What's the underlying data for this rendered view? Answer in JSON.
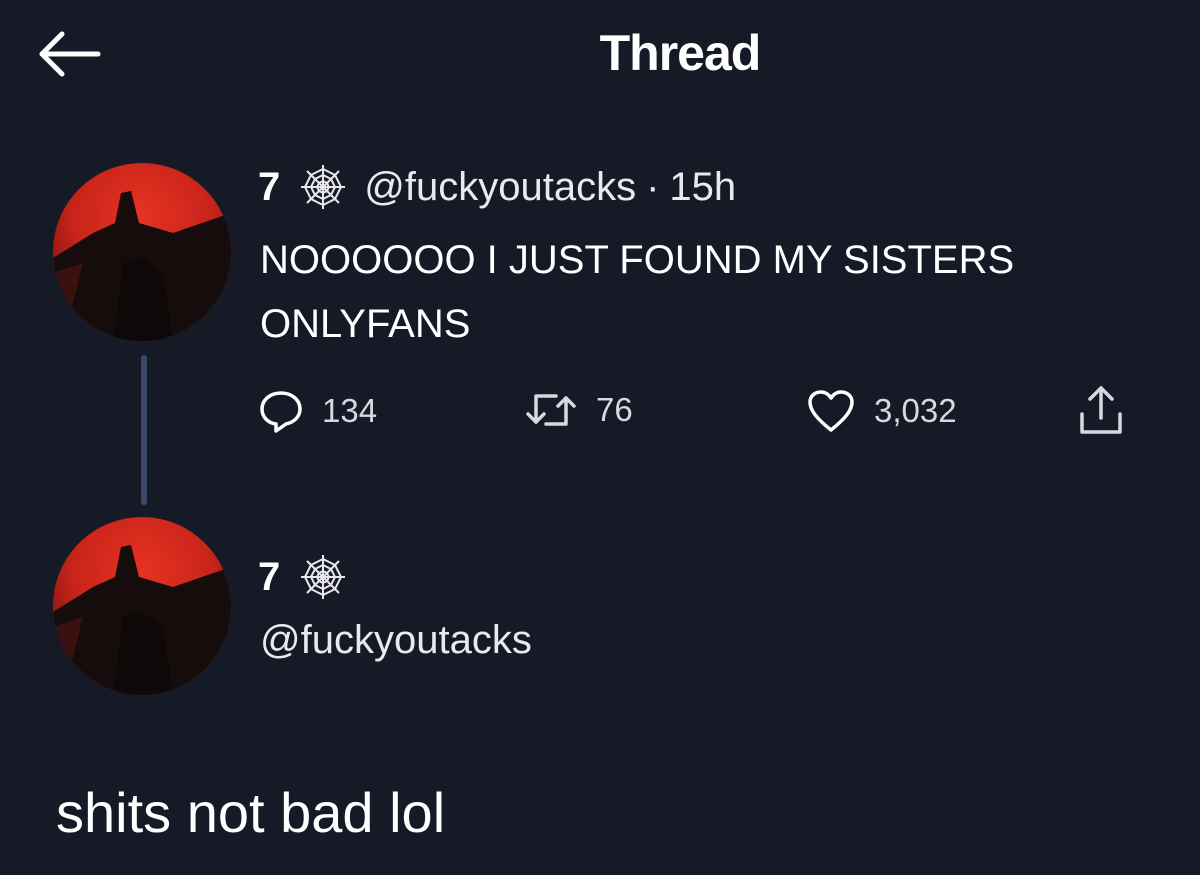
{
  "header": {
    "title": "Thread",
    "back_icon": "arrow-left-icon"
  },
  "tweet": {
    "display_name": "7",
    "badge_icon": "spiderweb-icon",
    "handle": "@fuckyoutacks",
    "separator": "·",
    "time": "15h",
    "text": "NOOOOOO I JUST FOUND MY SISTERS ONLYFANS",
    "actions": {
      "reply_count": "134",
      "retweet_count": "76",
      "like_count": "3,032",
      "reply_icon": "reply-bubble-icon",
      "retweet_icon": "retweet-icon",
      "like_icon": "heart-icon",
      "share_icon": "share-icon"
    }
  },
  "reply_author": {
    "display_name": "7",
    "badge_icon": "spiderweb-icon",
    "handle": "@fuckyoutacks"
  },
  "caption": "shits not bad lol",
  "colors": {
    "background": "#161a27",
    "thread_line": "#3b4a6b",
    "avatar_red": "#e63322"
  }
}
